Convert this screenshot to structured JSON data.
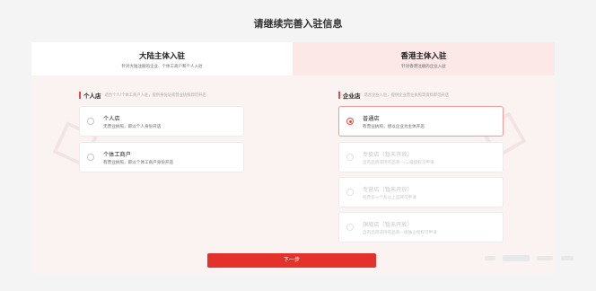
{
  "page": {
    "title": "请继续完善入驻信息"
  },
  "tabs": [
    {
      "title": "大陆主体入驻",
      "subtitle": "针对大陆注册的企业、个体工商户和个人入驻"
    },
    {
      "title": "香港主体入驻",
      "subtitle": "针对香港注册的企业入驻"
    }
  ],
  "personal": {
    "title": "个人店",
    "desc": "适合个人/个体工商户入驻，提供身份证或营业执照即可开店",
    "options": [
      {
        "name": "个人店",
        "sub": "无营业执照，即以个人身份开店"
      },
      {
        "name": "个体工商户",
        "sub": "有营业执照，即以个体工商户身份开店"
      }
    ]
  },
  "enterprise": {
    "title": "企业店",
    "desc": "适合企业入驻，提供企业营业执照等资料即可开店",
    "options": [
      {
        "name": "普通店",
        "sub": "有营业执照，想以企业为主体开店"
      },
      {
        "name": "专卖店（暂未开放）",
        "sub": "自有品牌或持有品牌一/二级授权可申请"
      },
      {
        "name": "专营店（暂未开放）",
        "sub": "经营多一个及以上品牌可申请"
      },
      {
        "name": "旗舰店（暂未开放）",
        "sub": "自有品牌或持有品牌一级独占授权可申请"
      }
    ]
  },
  "actions": {
    "next_label": "下一步"
  },
  "colors": {
    "accent": "#e3322b",
    "tab_active_bg": "#fde8e8",
    "content_bg": "#fbf2f2"
  },
  "selection": {
    "selected_option": "普通店"
  }
}
